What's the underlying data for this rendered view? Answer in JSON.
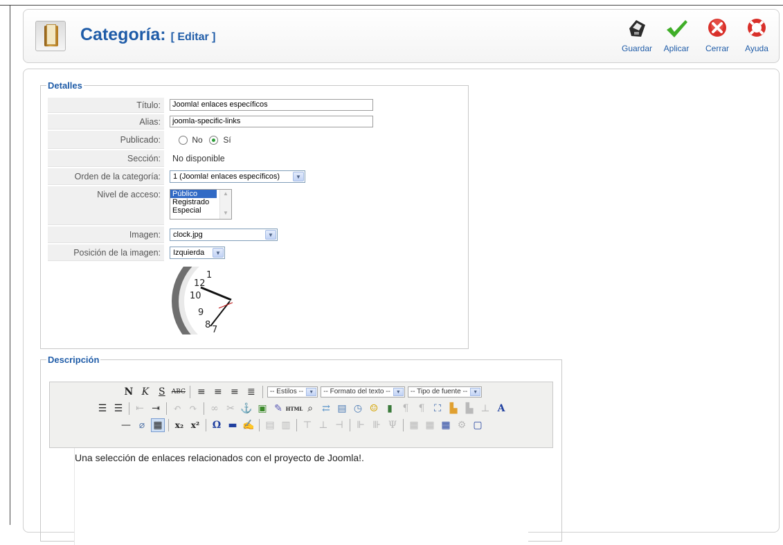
{
  "header": {
    "title": "Categoría:",
    "subtitle": "[ Editar ]",
    "buttons": [
      {
        "label": "Guardar",
        "icon": "save-icon"
      },
      {
        "label": "Aplicar",
        "icon": "apply-check-icon"
      },
      {
        "label": "Cerrar",
        "icon": "close-icon"
      },
      {
        "label": "Ayuda",
        "icon": "help-lifebuoy-icon"
      }
    ]
  },
  "details": {
    "legend": "Detalles",
    "title_label": "Título:",
    "title_value": "Joomla! enlaces específicos",
    "alias_label": "Alias:",
    "alias_value": "joomla-specific-links",
    "published_label": "Publicado:",
    "published_no": "No",
    "published_yes": "Sí",
    "published_selected": "Sí",
    "section_label": "Sección:",
    "section_value": "No disponible",
    "order_label": "Orden de la categoría:",
    "order_value": "1 (Joomla! enlaces específicos)",
    "access_label": "Nivel de acceso:",
    "access_options": [
      "Público",
      "Registrado",
      "Especial"
    ],
    "access_selected": "Público",
    "image_label": "Imagen:",
    "image_value": "clock.jpg",
    "image_position_label": "Posición de la imagen:",
    "image_position_value": "Izquierda"
  },
  "description": {
    "legend": "Descripción",
    "styles_select": "-- Estilos --",
    "format_select": "-- Formato del texto --",
    "font_select": "-- Tipo de fuente --",
    "content": "Una selección de enlaces relacionados con el proyecto de Joomla!."
  },
  "colors": {
    "accent": "#1f5ca8",
    "label_bg": "#f0f0f0",
    "border": "#cfcfcf"
  }
}
